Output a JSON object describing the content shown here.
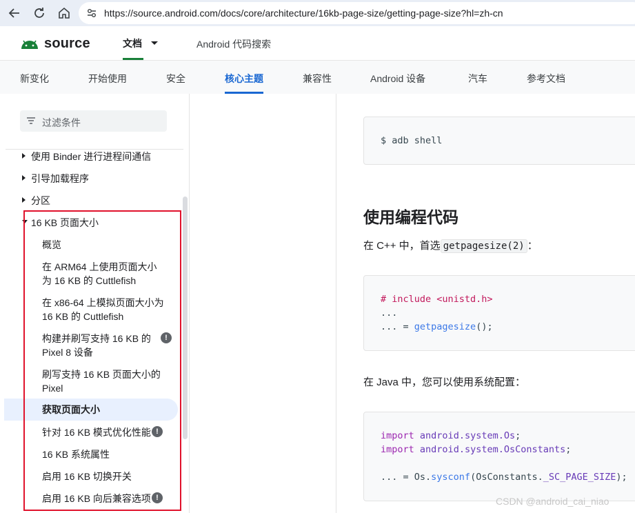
{
  "browser": {
    "url": "https://source.android.com/docs/core/architecture/16kb-page-size/getting-page-size?hl=zh-cn",
    "icons": [
      "back-icon",
      "reload-icon",
      "home-icon",
      "site-info-icon"
    ]
  },
  "header": {
    "logo_text": "source",
    "docs_label": "文档",
    "code_search_label": "Android 代码搜索",
    "brand_color": "#188038"
  },
  "tabs": [
    {
      "label": "新变化"
    },
    {
      "label": "开始使用"
    },
    {
      "label": "安全"
    },
    {
      "label": "核心主题"
    },
    {
      "label": "兼容性"
    },
    {
      "label": "Android 设备"
    },
    {
      "label": "汽车"
    },
    {
      "label": "参考文档"
    }
  ],
  "active_tab": "核心主题",
  "sidebar": {
    "filter_placeholder": "过滤条件",
    "top_items": [
      {
        "label": "使用 Binder 进行进程间通信"
      },
      {
        "label": "引导加载程序"
      },
      {
        "label": "分区"
      },
      {
        "label": "16 KB 页面大小"
      }
    ],
    "sub_items": [
      {
        "label": "概览"
      },
      {
        "label": "在 ARM64 上使用页面大小为 16 KB 的 Cuttlefish"
      },
      {
        "label": "在 x86-64 上模拟页面大小为 16 KB 的 Cuttlefish"
      },
      {
        "label": "构建并刷写支持 16 KB 的 Pixel 8 设备"
      },
      {
        "label": "刷写支持 16 KB 页面大小的 Pixel"
      },
      {
        "label": "获取页面大小"
      },
      {
        "label": "针对 16 KB 模式优化性能"
      },
      {
        "label": "16 KB 系统属性"
      },
      {
        "label": "启用 16 KB 切换开关"
      },
      {
        "label": "启用 16 KB 向后兼容选项"
      }
    ],
    "active_item": "获取页面大小",
    "highlight_color": "#e0112b"
  },
  "content": {
    "code1": "$ adb shell",
    "heading": "使用编程代码",
    "para1_prefix": "在 C++ 中，首选",
    "para1_code": "getpagesize(2)",
    "para1_suffix": "：",
    "code2": {
      "line1": "# include <unistd.h>",
      "line2": "...",
      "line3_prefix": "... = ",
      "line3_fn": "getpagesize",
      "line3_suffix": "();"
    },
    "para2": "在 Java 中，您可以使用系统配置：",
    "code3": {
      "import_kw": "import",
      "import1": "android.system.Os",
      "import2": "android.system.OsConstants",
      "line3_prefix": "... = Os.",
      "line3_fn": "sysconf",
      "line3_args": "(OsConstants.",
      "line3_const": "_SC_PAGE_SIZE",
      "line3_end": ");"
    }
  },
  "watermark": "CSDN @android_cai_niao"
}
